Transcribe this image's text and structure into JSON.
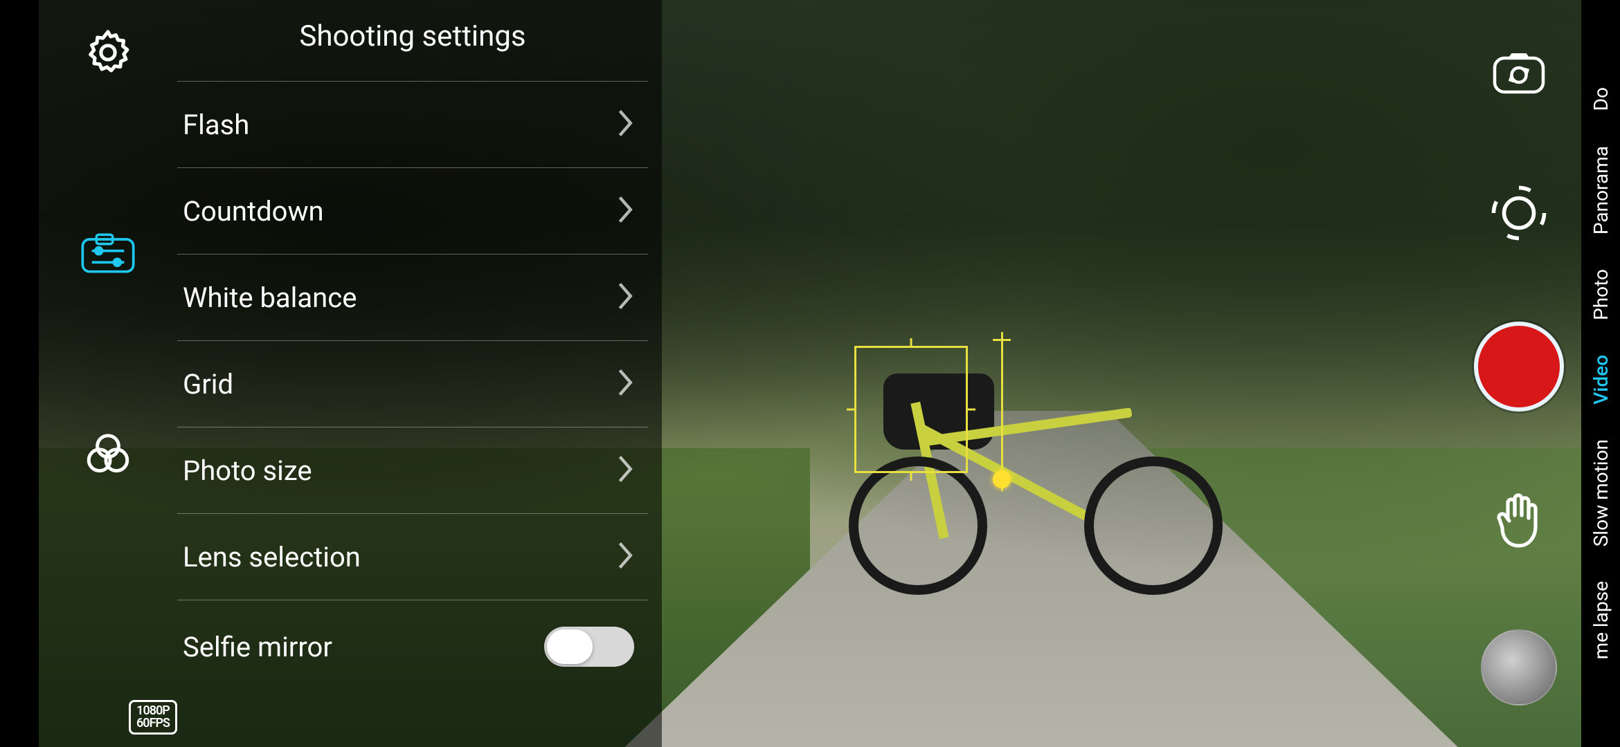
{
  "settings": {
    "title": "Shooting settings",
    "items": [
      {
        "label": "Flash"
      },
      {
        "label": "Countdown"
      },
      {
        "label": "White balance"
      },
      {
        "label": "Grid"
      },
      {
        "label": "Photo size"
      },
      {
        "label": "Lens selection"
      },
      {
        "label": "Selfie mirror"
      }
    ],
    "selfie_mirror_on": false,
    "resolution": {
      "line1": "1080P",
      "line2": "60FPS"
    }
  },
  "sidebar_icons": {
    "settings": "gear",
    "shooting": "camera-sliders",
    "filters": "color-filters"
  },
  "right_controls": {
    "switch_camera": "switch-camera",
    "focus_mode": "focus-ring",
    "gesture": "palm",
    "shutter": "record",
    "gallery": "last-photo"
  },
  "modes": [
    {
      "label": "Do",
      "active": false
    },
    {
      "label": "Panorama",
      "active": false
    },
    {
      "label": "Photo",
      "active": false
    },
    {
      "label": "Video",
      "active": true
    },
    {
      "label": "Slow motion",
      "active": false
    },
    {
      "label": "me lapse",
      "active": false
    }
  ]
}
